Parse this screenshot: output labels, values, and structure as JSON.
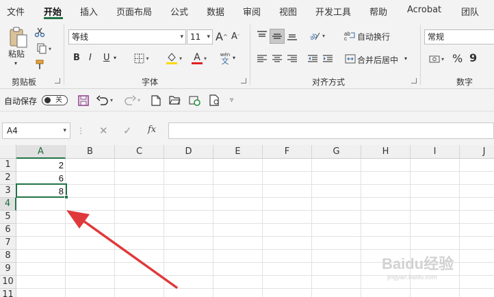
{
  "ribbon_tabs": [
    "文件",
    "开始",
    "插入",
    "页面布局",
    "公式",
    "数据",
    "审阅",
    "视图",
    "开发工具",
    "帮助",
    "Acrobat",
    "团队"
  ],
  "active_tab": "开始",
  "clipboard": {
    "paste_label": "粘贴",
    "group_label": "剪贴板"
  },
  "font": {
    "font_name": "等线",
    "font_size": "11",
    "bold": "B",
    "italic": "I",
    "underline": "U",
    "font_color_letter": "A",
    "phonetic_top": "wén",
    "phonetic_char": "文",
    "group_label": "字体"
  },
  "alignment": {
    "wrap_text": "自动换行",
    "merge_center": "合并后居中",
    "group_label": "对齐方式"
  },
  "number": {
    "format": "常规",
    "percent": "%",
    "comma": "9",
    "group_label": "数字"
  },
  "qat": {
    "autosave_label": "自动保存",
    "autosave_state": "关"
  },
  "formula_bar": {
    "name_box": "A4",
    "fx": "fx",
    "formula": ""
  },
  "sheet": {
    "columns": [
      "A",
      "B",
      "C",
      "D",
      "E",
      "F",
      "G",
      "H",
      "I",
      "J"
    ],
    "rows": [
      "1",
      "2",
      "3",
      "4",
      "5",
      "6",
      "7",
      "8",
      "9",
      "10",
      "11"
    ],
    "selected_cell": "A4",
    "cells": {
      "A1": "2",
      "A2": "6",
      "A3": "8"
    }
  },
  "watermark": {
    "text": "Baidu经验",
    "sub": "jingyan.baidu.com"
  },
  "colors": {
    "accent": "#217346",
    "arrow": "#e0393b"
  },
  "icons": [
    "paste-icon",
    "cut-icon",
    "copy-icon",
    "format-painter-icon",
    "grow-font-icon",
    "shrink-font-icon",
    "borders-icon",
    "fill-color-icon",
    "font-color-icon",
    "phonetic-icon",
    "align-top-icon",
    "align-middle-icon",
    "align-bottom-icon",
    "orientation-icon",
    "align-left-icon",
    "align-center-icon",
    "align-right-icon",
    "decrease-indent-icon",
    "increase-indent-icon",
    "wrap-text-icon",
    "merge-center-icon",
    "accounting-format-icon",
    "save-icon",
    "undo-icon",
    "redo-icon",
    "new-file-icon",
    "open-folder-icon",
    "refresh-icon",
    "print-preview-icon",
    "customize-qat-icon",
    "cancel-icon",
    "enter-icon"
  ]
}
